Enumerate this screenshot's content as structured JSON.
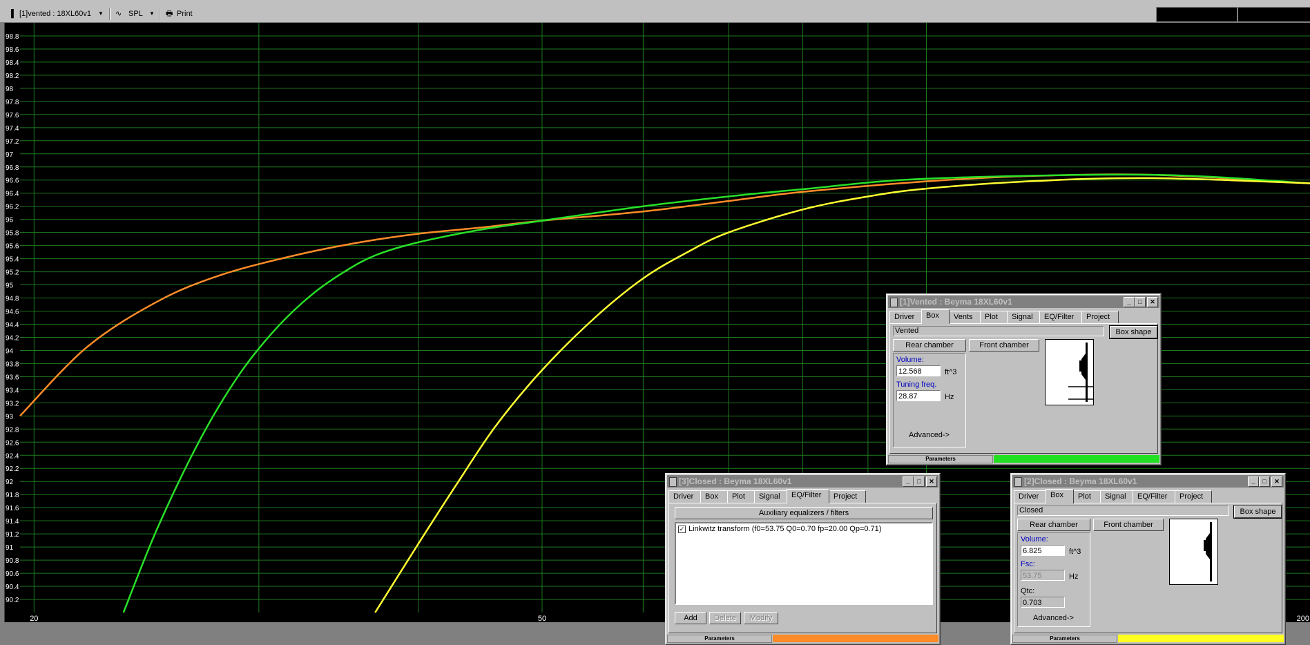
{
  "toolbar": {
    "driver_select": "[1]vented : 18XL60v1",
    "plot_select": "SPL",
    "print_label": "Print"
  },
  "chart_data": {
    "type": "line",
    "x_scale": "log",
    "xlim": [
      19.5,
      200
    ],
    "ylim": [
      90,
      99
    ],
    "x_tick_labels": [
      "20",
      "50",
      "200"
    ],
    "y_tick_labels": [
      "98.8",
      "98.6",
      "98.4",
      "98.2",
      "98",
      "97.8",
      "97.6",
      "97.4",
      "97.2",
      "97",
      "96.8",
      "96.6",
      "96.4",
      "96.2",
      "96",
      "95.8",
      "95.6",
      "95.4",
      "95.2",
      "95",
      "94.8",
      "94.6",
      "94.4",
      "94.2",
      "94",
      "93.8",
      "93.6",
      "93.4",
      "93.2",
      "93",
      "92.8",
      "92.6",
      "92.4",
      "92.2",
      "92",
      "91.8",
      "91.6",
      "91.4",
      "91.2",
      "91",
      "90.8",
      "90.6",
      "90.4",
      "90.2"
    ],
    "grid": true,
    "series": [
      {
        "color": "#ff8c28",
        "x": [
          19.5,
          22,
          25,
          28,
          32,
          36,
          40,
          45,
          50,
          60,
          70,
          80,
          100,
          120,
          150,
          200
        ],
        "y": [
          93.0,
          94.05,
          94.75,
          95.15,
          95.45,
          95.65,
          95.78,
          95.88,
          95.98,
          96.12,
          96.28,
          96.42,
          96.58,
          96.66,
          96.68,
          96.55
        ]
      },
      {
        "color": "#28e028",
        "x": [
          23.5,
          25,
          27,
          29,
          31,
          33,
          35,
          37,
          40,
          45,
          50,
          60,
          70,
          80,
          100,
          150,
          200
        ],
        "y": [
          90.0,
          91.3,
          92.65,
          93.65,
          94.35,
          94.85,
          95.2,
          95.45,
          95.65,
          95.85,
          95.98,
          96.2,
          96.35,
          96.46,
          96.62,
          96.68,
          96.55
        ]
      },
      {
        "color": "#ffff32",
        "x": [
          37,
          40,
          43,
          46,
          50,
          55,
          60,
          65,
          70,
          80,
          90,
          100,
          120,
          150,
          200
        ],
        "y": [
          90.0,
          91.05,
          92.0,
          92.85,
          93.7,
          94.5,
          95.1,
          95.5,
          95.8,
          96.15,
          96.35,
          96.47,
          96.58,
          96.63,
          96.55
        ]
      }
    ]
  },
  "windows": {
    "vented": {
      "title": "[1]Vented : Beyma 18XL60v1",
      "tabs": [
        "Driver",
        "Box",
        "Vents",
        "Plot",
        "Signal",
        "EQ/Filter",
        "Project"
      ],
      "box_type": "Vented",
      "box_shape_label": "Box shape",
      "rear_chamber_label": "Rear chamber",
      "front_chamber_label": "Front chamber",
      "volume_label": "Volume:",
      "volume_value": "12.568",
      "volume_unit": "ft^3",
      "tuning_label": "Tuning freq.",
      "tuning_value": "28.87",
      "tuning_unit": "Hz",
      "advanced_label": "Advanced->",
      "status_label": "Parameters",
      "status_color": "#20e020"
    },
    "closed3": {
      "title": "[3]Closed : Beyma 18XL60v1",
      "tabs": [
        "Driver",
        "Box",
        "Plot",
        "Signal",
        "EQ/Filter",
        "Project"
      ],
      "aux_label": "Auxiliary equalizers / filters",
      "checkbox_mark": "✓",
      "list_item": "Linkwitz transform (f0=53.75 Q0=0.70 fp=20.00 Qp=0.71)",
      "add_label": "Add",
      "delete_label": "Delete",
      "modify_label": "Modify",
      "status_label": "Parameters",
      "status_color": "#ff8c28"
    },
    "closed2": {
      "title": "[2]Closed : Beyma 18XL60v1",
      "tabs": [
        "Driver",
        "Box",
        "Plot",
        "Signal",
        "EQ/Filter",
        "Project"
      ],
      "box_type": "Closed",
      "box_shape_label": "Box shape",
      "rear_chamber_label": "Rear chamber",
      "front_chamber_label": "Front chamber",
      "volume_label": "Volume:",
      "volume_value": "6.825",
      "volume_unit": "ft^3",
      "fsc_label": "Fsc:",
      "fsc_value": "53.75",
      "fsc_unit": "Hz",
      "qtc_label": "Qtc:",
      "qtc_value": "0.703",
      "advanced_label": "Advanced->",
      "status_label": "Parameters",
      "status_color": "#ffff20"
    }
  }
}
